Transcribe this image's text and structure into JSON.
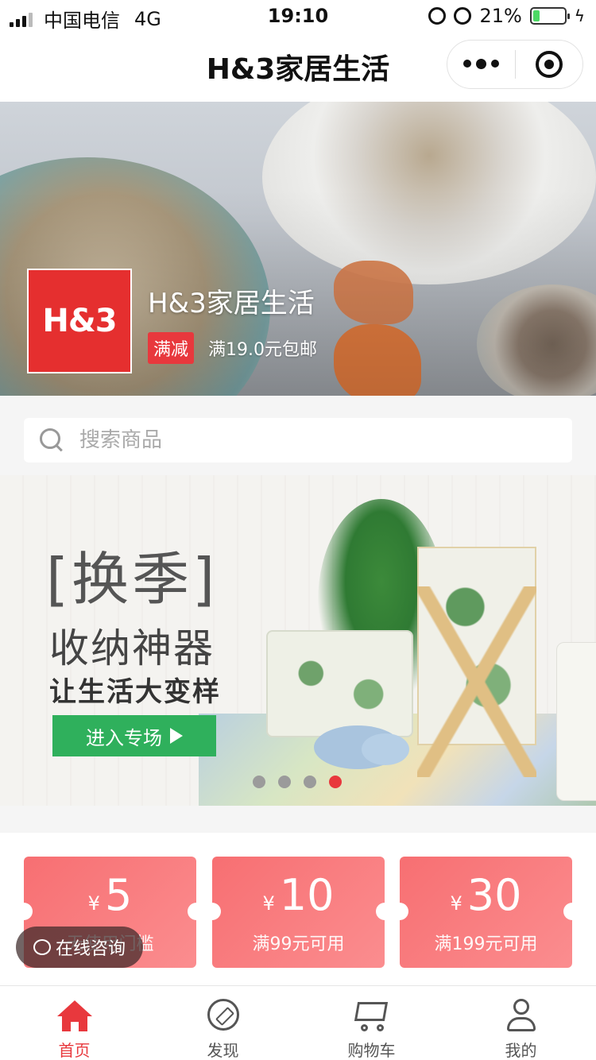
{
  "status_bar": {
    "carrier": "中国电信",
    "network": "4G",
    "time": "19:10",
    "battery": "21%",
    "battery_level": 0.21
  },
  "nav": {
    "title": "H&3家居生活"
  },
  "shop": {
    "logo_text": "H&3",
    "name": "H&3家居生活",
    "promo_tag": "满减",
    "promo_text": "满19.0元包邮"
  },
  "search": {
    "placeholder": "搜索商品"
  },
  "banner": {
    "headline": "[换季]",
    "subhead": "收纳神器",
    "slogan": "让生活大变样",
    "cta_label": "进入专场",
    "slide_count": 4,
    "active_slide": 4
  },
  "coupons": [
    {
      "currency": "¥",
      "amount": "5",
      "condition": "无使用门槛"
    },
    {
      "currency": "¥",
      "amount": "10",
      "condition": "满99元可用"
    },
    {
      "currency": "¥",
      "amount": "30",
      "condition": "满199元可用"
    }
  ],
  "chat_button": {
    "label": "在线咨询"
  },
  "tabbar": {
    "items": [
      {
        "label": "首页",
        "icon": "home-icon",
        "active": true
      },
      {
        "label": "发现",
        "icon": "compass-icon",
        "active": false
      },
      {
        "label": "购物车",
        "icon": "cart-icon",
        "active": false
      },
      {
        "label": "我的",
        "icon": "user-icon",
        "active": false
      }
    ]
  },
  "colors": {
    "accent": "#e8383d",
    "cta_green": "#2fb05c",
    "coupon": "#f76f72"
  }
}
